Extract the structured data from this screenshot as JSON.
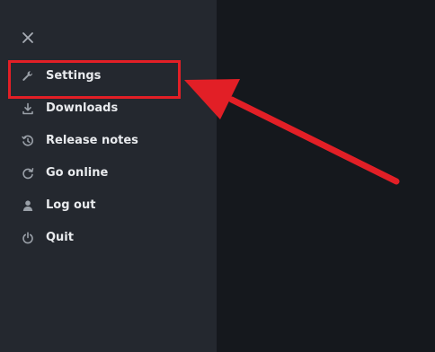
{
  "menu": {
    "close_icon": "close-icon",
    "items": [
      {
        "label": "Settings",
        "icon": "wrench-icon"
      },
      {
        "label": "Downloads",
        "icon": "download-icon"
      },
      {
        "label": "Release notes",
        "icon": "release-notes-icon"
      },
      {
        "label": "Go online",
        "icon": "refresh-icon"
      },
      {
        "label": "Log out",
        "icon": "user-icon"
      },
      {
        "label": "Quit",
        "icon": "power-icon"
      }
    ]
  },
  "annotation": {
    "highlight_color": "#e21f26",
    "arrow_color": "#e21f26",
    "highlighted_item": "Settings"
  },
  "colors": {
    "sidebar_bg": "#24282f",
    "main_bg": "#15181d",
    "text": "#e8eaed",
    "icon": "#9aa0a8"
  }
}
